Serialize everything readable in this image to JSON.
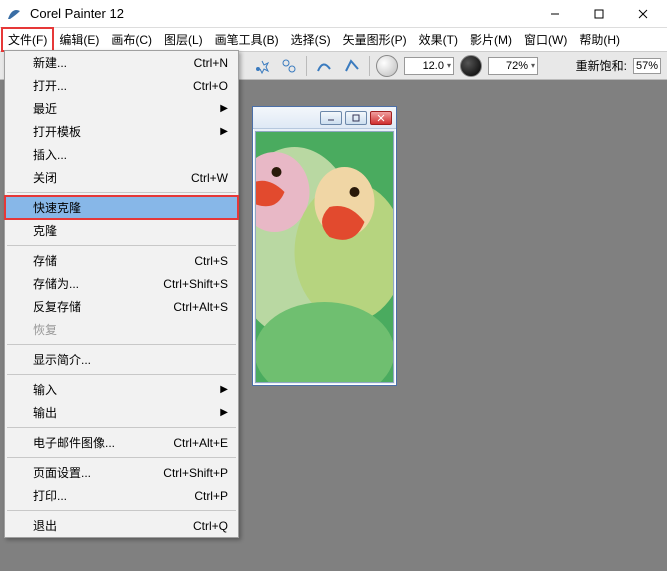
{
  "title": "Corel Painter 12",
  "menubar": [
    "文件(F)",
    "编辑(E)",
    "画布(C)",
    "图层(L)",
    "画笔工具(B)",
    "选择(S)",
    "矢量图形(P)",
    "效果(T)",
    "影片(M)",
    "窗口(W)",
    "帮助(H)"
  ],
  "toolbar": {
    "size_value": "12.0",
    "opacity_value": "72%",
    "resat_label": "重新饱和:",
    "resat_value": "57%"
  },
  "dropdown": [
    {
      "type": "item",
      "label": "新建...",
      "shortcut": "Ctrl+N"
    },
    {
      "type": "item",
      "label": "打开...",
      "shortcut": "Ctrl+O"
    },
    {
      "type": "item",
      "label": "最近",
      "submenu": true
    },
    {
      "type": "item",
      "label": "打开模板",
      "submenu": true
    },
    {
      "type": "item",
      "label": "插入..."
    },
    {
      "type": "item",
      "label": "关闭",
      "shortcut": "Ctrl+W"
    },
    {
      "type": "sep"
    },
    {
      "type": "item",
      "label": "快速克隆",
      "highlight": true
    },
    {
      "type": "item",
      "label": "克隆"
    },
    {
      "type": "sep"
    },
    {
      "type": "item",
      "label": "存储",
      "shortcut": "Ctrl+S"
    },
    {
      "type": "item",
      "label": "存储为...",
      "shortcut": "Ctrl+Shift+S"
    },
    {
      "type": "item",
      "label": "反复存储",
      "shortcut": "Ctrl+Alt+S"
    },
    {
      "type": "item",
      "label": "恢复",
      "disabled": true
    },
    {
      "type": "sep"
    },
    {
      "type": "item",
      "label": "显示简介..."
    },
    {
      "type": "sep"
    },
    {
      "type": "item",
      "label": "输入",
      "submenu": true
    },
    {
      "type": "item",
      "label": "输出",
      "submenu": true
    },
    {
      "type": "sep"
    },
    {
      "type": "item",
      "label": "电子邮件图像...",
      "shortcut": "Ctrl+Alt+E"
    },
    {
      "type": "sep"
    },
    {
      "type": "item",
      "label": "页面设置...",
      "shortcut": "Ctrl+Shift+P"
    },
    {
      "type": "item",
      "label": "打印...",
      "shortcut": "Ctrl+P"
    },
    {
      "type": "sep"
    },
    {
      "type": "item",
      "label": "退出",
      "shortcut": "Ctrl+Q"
    }
  ]
}
